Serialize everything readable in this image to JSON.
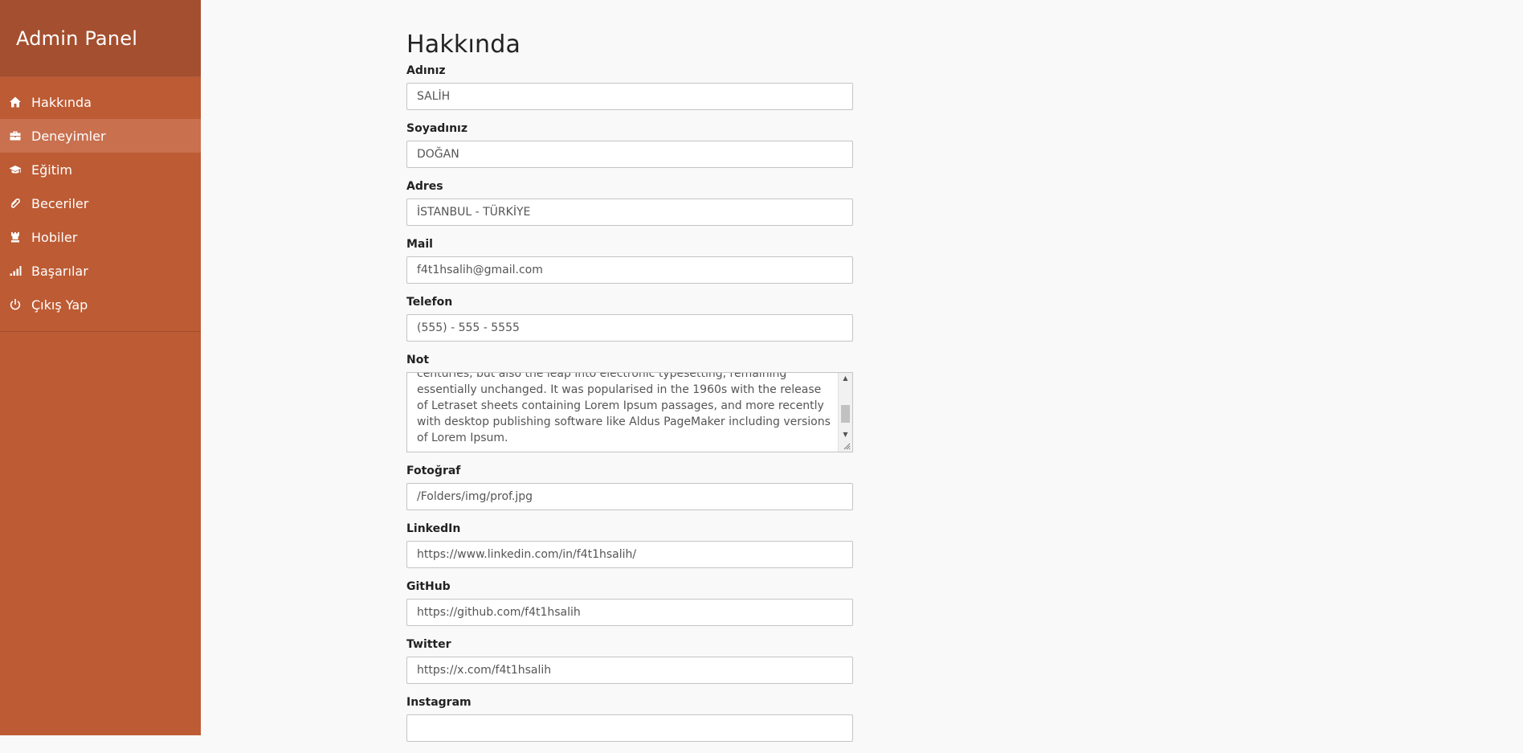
{
  "sidebar": {
    "brand": "Admin Panel",
    "items": [
      {
        "label": "Hakkında"
      },
      {
        "label": "Deneyimler"
      },
      {
        "label": "Eğitim"
      },
      {
        "label": "Beceriler"
      },
      {
        "label": "Hobiler"
      },
      {
        "label": "Başarılar"
      },
      {
        "label": "Çıkış Yap"
      }
    ]
  },
  "main": {
    "title": "Hakkında",
    "fields": {
      "first_name": {
        "label": "Adınız",
        "value": "SALİH"
      },
      "last_name": {
        "label": "Soyadınız",
        "value": "DOĞAN"
      },
      "address": {
        "label": "Adres",
        "value": "İSTANBUL - TÜRKİYE"
      },
      "mail": {
        "label": "Mail",
        "value": "f4t1hsalih@gmail.com"
      },
      "phone": {
        "label": "Telefon",
        "value": "(555) - 555 - 5555"
      },
      "note": {
        "label": "Not",
        "value": "centuries, but also the leap into electronic typesetting, remaining essentially unchanged. It was popularised in the 1960s with the release of Letraset sheets containing Lorem Ipsum passages, and more recently with desktop publishing software like Aldus PageMaker including versions of Lorem Ipsum."
      },
      "photo": {
        "label": "Fotoğraf",
        "value": "/Folders/img/prof.jpg"
      },
      "linkedin": {
        "label": "LinkedIn",
        "value": "https://www.linkedin.com/in/f4t1hsalih/"
      },
      "github": {
        "label": "GitHub",
        "value": "https://github.com/f4t1hsalih"
      },
      "twitter": {
        "label": "Twitter",
        "value": "https://x.com/f4t1hsalih"
      },
      "instagram": {
        "label": "Instagram"
      }
    }
  },
  "colors": {
    "sidebar_bg": "#bd5b34",
    "brand_bg": "#a44f2f",
    "active_item_bg": "#c9704f",
    "page_bg": "#f9f9f9"
  },
  "icons": [
    "home-icon",
    "briefcase-icon",
    "graduation-cap-icon",
    "paperclip-icon",
    "rook-icon",
    "signal-bars-icon",
    "power-icon"
  ]
}
